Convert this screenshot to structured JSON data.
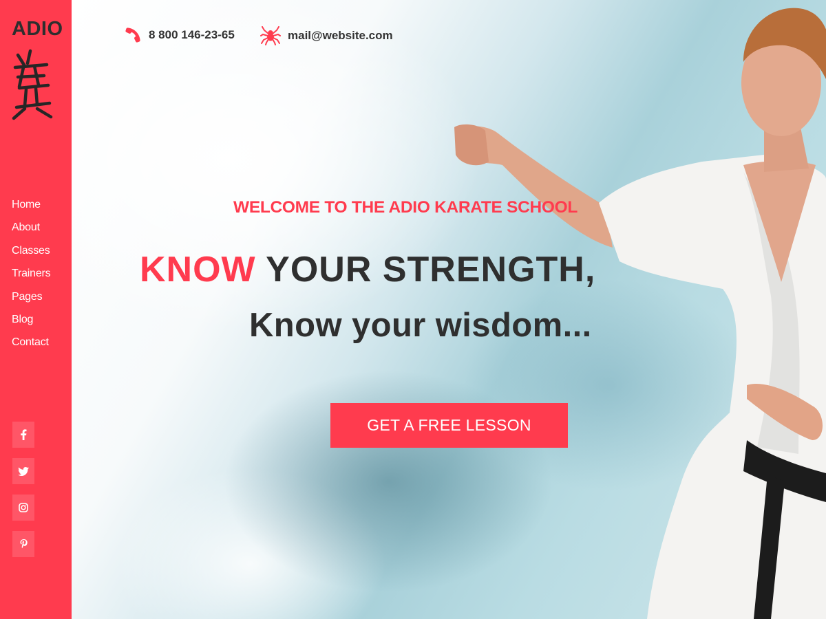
{
  "brand": {
    "name": "ADIO"
  },
  "nav": [
    {
      "label": "Home"
    },
    {
      "label": "About"
    },
    {
      "label": "Classes"
    },
    {
      "label": "Trainers"
    },
    {
      "label": "Pages"
    },
    {
      "label": "Blog"
    },
    {
      "label": "Contact"
    }
  ],
  "socials": [
    {
      "icon": "facebook-icon"
    },
    {
      "icon": "twitter-icon"
    },
    {
      "icon": "instagram-icon"
    },
    {
      "icon": "pinterest-icon"
    }
  ],
  "contact": {
    "phone": "8 800 146-23-65",
    "phone_icon": "phone-icon",
    "email": "mail@website.com",
    "email_icon": "spider-icon"
  },
  "hero": {
    "subtitle": "WELCOME TO THE ADIO KARATE SCHOOL",
    "headline_accent": "KNOW",
    "headline_rest": " YOUR STRENGTH,",
    "tagline": "Know your wisdom...",
    "cta_label": "GET A FREE LESSON"
  },
  "colors": {
    "accent": "#ff3b4e",
    "text_dark": "#2f2f2f",
    "white": "#ffffff"
  }
}
